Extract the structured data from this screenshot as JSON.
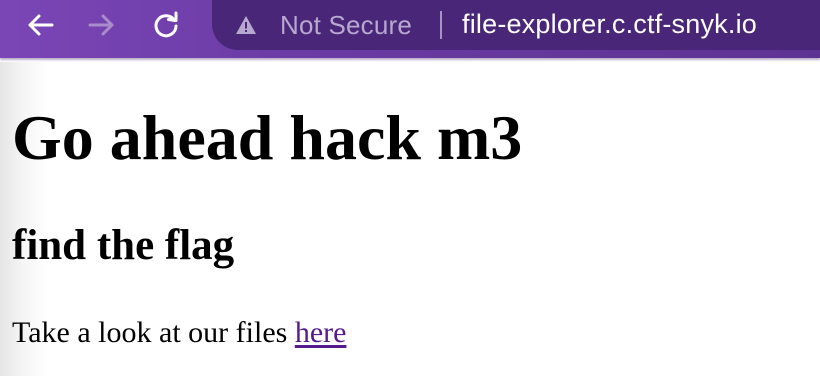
{
  "toolbar": {
    "back_icon": "arrow-left-icon",
    "forward_icon": "arrow-right-icon",
    "reload_icon": "reload-icon",
    "security_icon": "warning-triangle-icon",
    "security_label": "Not Secure",
    "url": "file-explorer.c.ctf-snyk.io",
    "accent_color": "#6a3ba3"
  },
  "page": {
    "heading": "Go ahead hack m3",
    "subheading": "find the flag",
    "paragraph_text": "Take a look at our files ",
    "link_text": "here",
    "link_color": "#551a8b"
  }
}
